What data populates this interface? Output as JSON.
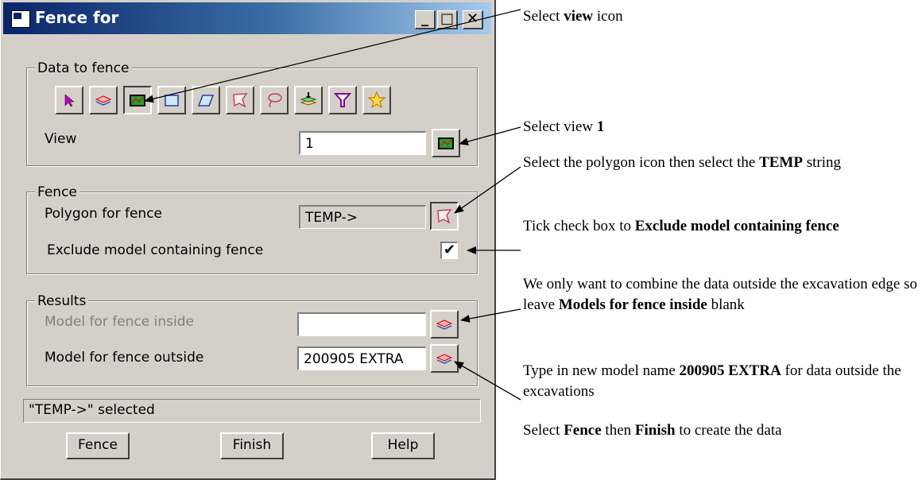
{
  "window": {
    "title": "Fence for",
    "minimize": "_",
    "maximize": "□",
    "close": "✕"
  },
  "data_to_fence": {
    "legend": "Data to fence",
    "icons": [
      "select-arrow-icon",
      "layers-icon",
      "view-icon",
      "rectangle-icon",
      "parallelogram-icon",
      "polygon-icon",
      "lasso-icon",
      "stack-icon",
      "funnel-icon",
      "star-icon"
    ],
    "view_label": "View",
    "view_value": "1"
  },
  "fence": {
    "legend": "Fence",
    "polygon_label": "Polygon for fence",
    "polygon_value": "TEMP->",
    "exclude_label": "Exclude model containing fence",
    "exclude_checked": "✔"
  },
  "results": {
    "legend": "Results",
    "inside_label": "Model for fence inside",
    "inside_value": "",
    "outside_label": "Model for fence outside",
    "outside_value": "200905 EXTRA"
  },
  "status": "\"TEMP->\" selected",
  "buttons": {
    "fence": "Fence",
    "finish": "Finish",
    "help": "Help"
  },
  "annotations": {
    "a1": {
      "pre": "Select ",
      "b1": "view",
      "post": " icon"
    },
    "a2": {
      "pre": "Select view ",
      "b1": "1"
    },
    "a3": {
      "pre": "Select the polygon icon then select the ",
      "b1": "TEMP",
      "post": " string"
    },
    "a4": {
      "pre": "Tick check box to ",
      "b1": "Exclude model containing fence"
    },
    "a5": {
      "pre": "We only want to combine the data outside the excavation edge so leave ",
      "b1": "Models for fence inside",
      "post": " blank"
    },
    "a6": {
      "pre": "Type in new model name ",
      "b1": "200905 EXTRA",
      "post": " for data outside the excavations"
    },
    "a7": {
      "pre": "Select ",
      "b1": "Fence",
      "mid": " then ",
      "b2": "Finish",
      "post": " to create the data"
    }
  },
  "colors": {
    "titlebar": "#0a246a",
    "dialog": "#d4d0c8"
  }
}
